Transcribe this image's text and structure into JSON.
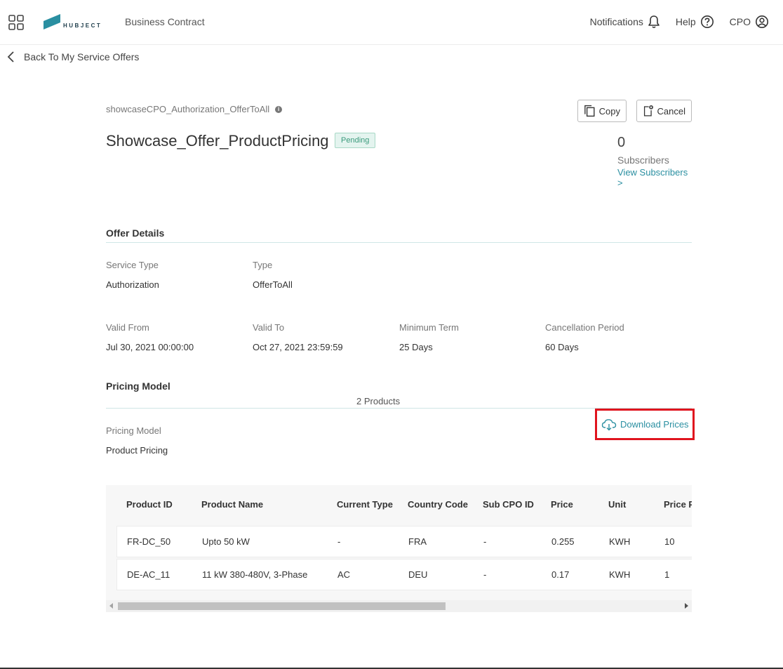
{
  "header": {
    "logo_text": "HUBJECT",
    "app_title": "Business Contract",
    "notifications_label": "Notifications",
    "help_label": "Help",
    "user_label": "CPO"
  },
  "back_link": {
    "label": "Back To My Service Offers"
  },
  "offer": {
    "code": "showcaseCPO_Authorization_OfferToAll",
    "name": "Showcase_Offer_ProductPricing",
    "status": "Pending",
    "copy_label": "Copy",
    "cancel_label": "Cancel",
    "subscribers_count": "0",
    "subscribers_label": "Subscribers",
    "view_subscribers_label": "View Subscribers >"
  },
  "offer_details": {
    "title": "Offer Details",
    "service_type_label": "Service Type",
    "service_type_value": "Authorization",
    "type_label": "Type",
    "type_value": "OfferToAll",
    "valid_from_label": "Valid From",
    "valid_from_value": "Jul 30, 2021 00:00:00",
    "valid_to_label": "Valid To",
    "valid_to_value": "Oct 27, 2021 23:59:59",
    "minimum_term_label": "Minimum Term",
    "minimum_term_value": "25 Days",
    "cancellation_period_label": "Cancellation Period",
    "cancellation_period_value": "60 Days"
  },
  "pricing": {
    "title": "Pricing Model",
    "products_count": "2 Products",
    "model_label": "Pricing Model",
    "model_value": "Product Pricing",
    "download_label": "Download Prices"
  },
  "table": {
    "columns": [
      "Product ID",
      "Product Name",
      "Current Type",
      "Country Code",
      "Sub CPO ID",
      "Price",
      "Unit",
      "Price P"
    ],
    "rows": [
      [
        "FR-DC_50",
        "Upto 50 kW",
        "-",
        "FRA",
        "-",
        "0.255",
        "KWH",
        "10"
      ],
      [
        "DE-AC_11",
        "11 kW 380-480V, 3-Phase",
        "AC",
        "DEU",
        "-",
        "0.17",
        "KWH",
        "1"
      ]
    ]
  },
  "colors": {
    "accent": "#2a8fa1",
    "highlight_border": "#e0141e",
    "badge_bg": "#e4f4ef",
    "badge_text": "#3b9a7c"
  }
}
